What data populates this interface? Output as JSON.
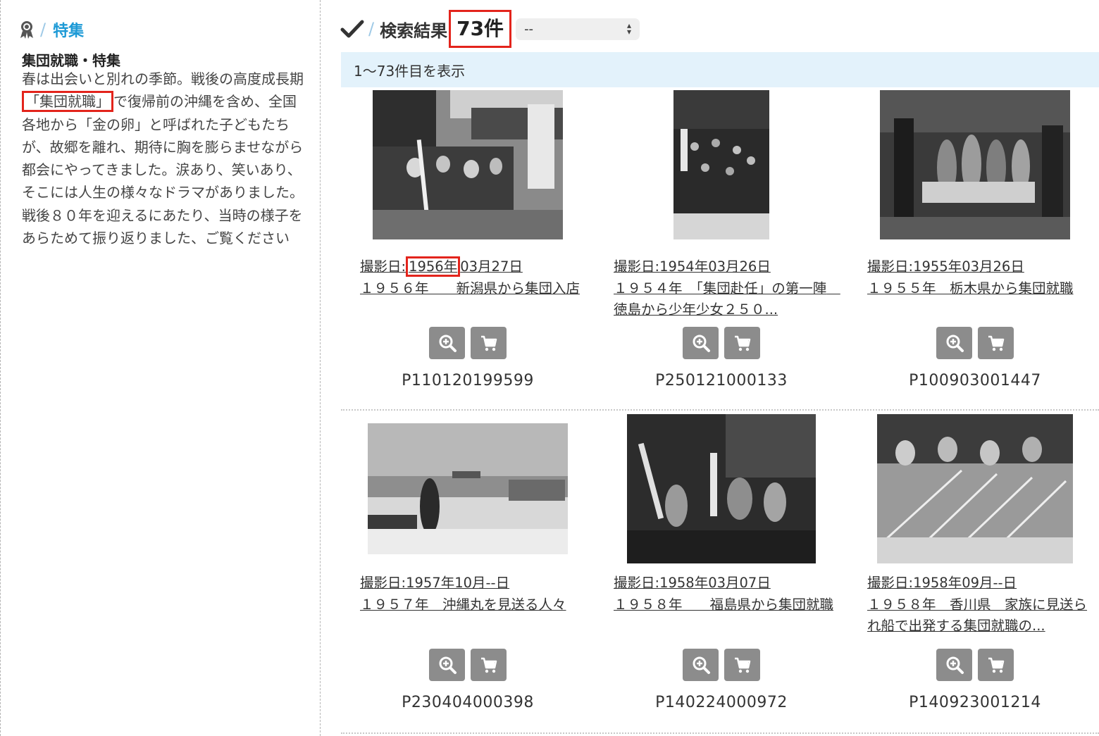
{
  "feature": {
    "heading": "特集",
    "title": "集団就職・特集",
    "desc_before": "春は出会いと別れの季節。戦後の高度成長期",
    "desc_highlight": "「集団就職」",
    "desc_after": "で復帰前の沖縄を含め、全国各地から「金の卵」と呼ばれた子どもたちが、故郷を離れ、期待に胸を膨らませながら都会にやってきました。涙あり、笑いあり、そこには人生の様々なドラマがありました。戦後８０年を迎えるにあたり、当時の様子をあらためて振り返りました、ご覧ください"
  },
  "results": {
    "title": "検索結果",
    "count": "73件",
    "sort_value": "--",
    "range_text": "1〜73件目を表示"
  },
  "items": [
    {
      "date_prefix": "撮影日:",
      "date_year": "1956年",
      "date_rest": "03月27日",
      "title": "１９５６年　　新潟県から集団入店",
      "code": "P110120199599"
    },
    {
      "date_prefix": "撮影日:",
      "date_year": "",
      "date_rest": "1954年03月26日",
      "title": "１９５４年　「集団赴任」の第一陣　徳島から少年少女２５０...",
      "code": "P250121000133"
    },
    {
      "date_prefix": "撮影日:",
      "date_year": "",
      "date_rest": "1955年03月26日",
      "title": "１９５５年　栃木県から集団就職",
      "code": "P100903001447"
    },
    {
      "date_prefix": "撮影日:",
      "date_year": "",
      "date_rest": "1957年10月--日",
      "title": "１９５７年　沖縄丸を見送る人々",
      "code": "P230404000398"
    },
    {
      "date_prefix": "撮影日:",
      "date_year": "",
      "date_rest": "1958年03月07日",
      "title": "１９５８年　　福島県から集団就職",
      "code": "P140224000972"
    },
    {
      "date_prefix": "撮影日:",
      "date_year": "",
      "date_rest": "1958年09月--日",
      "title": "１９５８年　香川県　家族に見送られ船で出発する集団就職の...",
      "code": "P140923001214"
    }
  ],
  "icons": {
    "feature": "ribbon-award-icon",
    "results": "checkmark-icon",
    "zoom": "zoom-in-icon",
    "cart": "cart-icon"
  },
  "colors": {
    "accent_blue": "#1d9ad6",
    "highlight_red": "#e3241c",
    "range_bar_bg": "#e3f2fb",
    "button_gray": "#8c8c8c"
  }
}
